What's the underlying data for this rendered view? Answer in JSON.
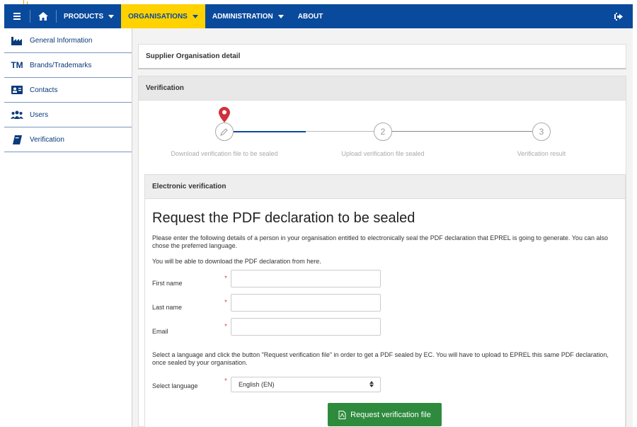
{
  "nav": {
    "products": "PRODUCTS",
    "organisations": "ORGANISATIONS",
    "administration": "ADMINISTRATION",
    "about": "ABOUT"
  },
  "sidebar": {
    "items": [
      {
        "label": "General Information",
        "icon": "factory-icon"
      },
      {
        "label": "Brands/Trademarks",
        "icon": "trademark-icon"
      },
      {
        "label": "Contacts",
        "icon": "contact-card-icon"
      },
      {
        "label": "Users",
        "icon": "users-icon"
      },
      {
        "label": "Verification",
        "icon": "book-icon"
      }
    ]
  },
  "main": {
    "supplier_title": "Supplier Organisation detail",
    "verification_title": "Verification",
    "steps": [
      {
        "number": "",
        "label": "Download verification file to be sealed"
      },
      {
        "number": "2",
        "label": "Upload verification file sealed"
      },
      {
        "number": "3",
        "label": "Verification result"
      }
    ],
    "ev": {
      "title": "Electronic verification",
      "heading": "Request the PDF declaration to be sealed",
      "intro": "Please enter the following details of a person in your organisation entitled to electronically seal the PDF declaration that EPREL is going to generate. You can also chose the preferred language.",
      "download_note": "You will be able to download the PDF declaration from here.",
      "first_name_label": "First name",
      "last_name_label": "Last name",
      "email_label": "Email",
      "required_mark": "*",
      "language_note": "Select a language and click the button \"Request verification file\" in order to get a PDF sealed by EC. You will have to upload to EPREL this same PDF declaration, once sealed by your organisation.",
      "select_language_label": "Select language",
      "language_value": "English (EN)",
      "request_button": "Request verification file"
    }
  },
  "colors": {
    "nav_bg": "#0a4a9c",
    "nav_active": "#ffd200",
    "button_green": "#2e8b3e",
    "pin_red": "#d0313a",
    "step_active_line": "#0a4a9c"
  }
}
